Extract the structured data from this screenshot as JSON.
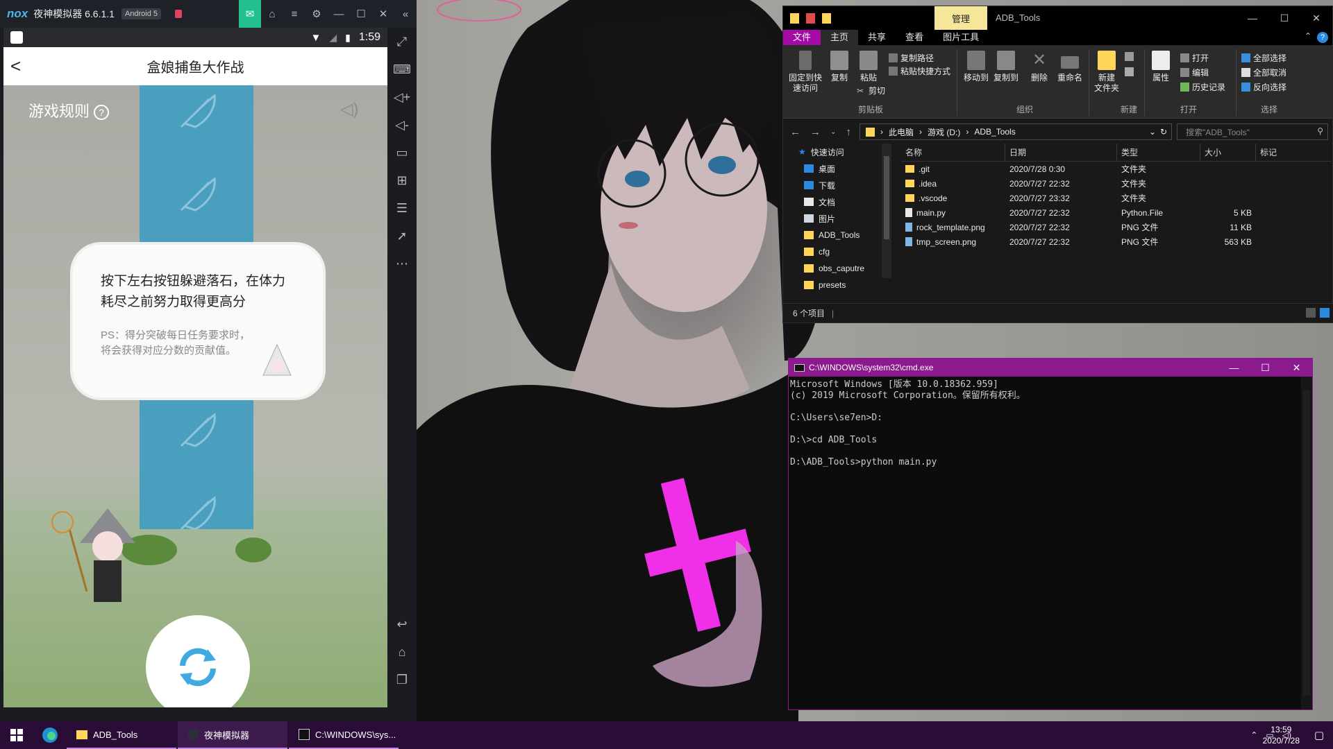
{
  "nox": {
    "logo": "nox",
    "title": "夜神模拟器 6.6.1.1",
    "android_badge": "Android 5",
    "phone_time": "1:59",
    "header_title": "盒娘捕鱼大作战",
    "back_glyph": "<",
    "game": {
      "rules_label": "游戏规则",
      "dialog_main": "按下左右按钮躲避落石，在体力耗尽之前努力取得更高分",
      "dialog_ps": "PS：得分突破每日任务要求时，将会获得对应分数的贡献值。"
    }
  },
  "explorer": {
    "title": "ADB_Tools",
    "manage_tab": "管理",
    "tabs": [
      "文件",
      "主页",
      "共享",
      "查看",
      "图片工具"
    ],
    "ribbon": {
      "pin": "固定到快速访问",
      "copy": "复制",
      "paste": "粘贴",
      "copy_path": "复制路径",
      "paste_shortcut": "粘贴快捷方式",
      "cut": "剪切",
      "move_to": "移动到",
      "copy_to": "复制到",
      "delete": "删除",
      "rename": "重命名",
      "new_folder": "新建\n文件夹",
      "properties": "属性",
      "open": "打开",
      "edit": "编辑",
      "history": "历史记录",
      "select_all": "全部选择",
      "select_none": "全部取消",
      "invert": "反向选择",
      "groups": [
        "剪贴板",
        "组织",
        "新建",
        "打开",
        "选择"
      ]
    },
    "breadcrumb": [
      "此电脑",
      "游戏 (D:)",
      "ADB_Tools"
    ],
    "search_placeholder": "搜索\"ADB_Tools\"",
    "nav": [
      {
        "label": "快速访问",
        "pinned": false
      },
      {
        "label": "桌面",
        "pinned": true
      },
      {
        "label": "下载",
        "pinned": true
      },
      {
        "label": "文档",
        "pinned": true
      },
      {
        "label": "图片",
        "pinned": true
      },
      {
        "label": "ADB_Tools",
        "pinned": false
      },
      {
        "label": "cfg",
        "pinned": false
      },
      {
        "label": "obs_caputre",
        "pinned": false
      },
      {
        "label": "presets",
        "pinned": false
      }
    ],
    "columns": [
      "名称",
      "日期",
      "类型",
      "大小",
      "标记"
    ],
    "files": [
      {
        "name": ".git",
        "date": "2020/7/28 0:30",
        "type": "文件夹",
        "size": "",
        "kind": "folder"
      },
      {
        "name": ".idea",
        "date": "2020/7/27 22:32",
        "type": "文件夹",
        "size": "",
        "kind": "folder"
      },
      {
        "name": ".vscode",
        "date": "2020/7/27 23:32",
        "type": "文件夹",
        "size": "",
        "kind": "folder"
      },
      {
        "name": "main.py",
        "date": "2020/7/27 22:32",
        "type": "Python.File",
        "size": "5 KB",
        "kind": "file"
      },
      {
        "name": "rock_template.png",
        "date": "2020/7/27 22:32",
        "type": "PNG 文件",
        "size": "11 KB",
        "kind": "png"
      },
      {
        "name": "tmp_screen.png",
        "date": "2020/7/27 22:32",
        "type": "PNG 文件",
        "size": "563 KB",
        "kind": "png"
      }
    ],
    "status": "6 个项目"
  },
  "cmd": {
    "title": "C:\\WINDOWS\\system32\\cmd.exe",
    "lines": [
      "Microsoft Windows [版本 10.0.18362.959]",
      "(c) 2019 Microsoft Corporation。保留所有权利。",
      "",
      "C:\\Users\\se7en>D:",
      "",
      "D:\\>cd ADB_Tools",
      "",
      "D:\\ADB_Tools>python main.py"
    ]
  },
  "taskbar": {
    "apps": [
      {
        "label": "ADB_Tools",
        "active": false
      },
      {
        "label": "夜神模拟器",
        "active": true
      },
      {
        "label": "C:\\WINDOWS\\sys...",
        "active": false
      }
    ],
    "time": "13:59",
    "date": "2020/7/28"
  },
  "colors": {
    "accent": "#8c1a8f",
    "file_tab": "#a30aa6",
    "taskbar": "#2a0d36",
    "waterfall": "#4b9fbe",
    "nox_active": "#22c08f"
  }
}
